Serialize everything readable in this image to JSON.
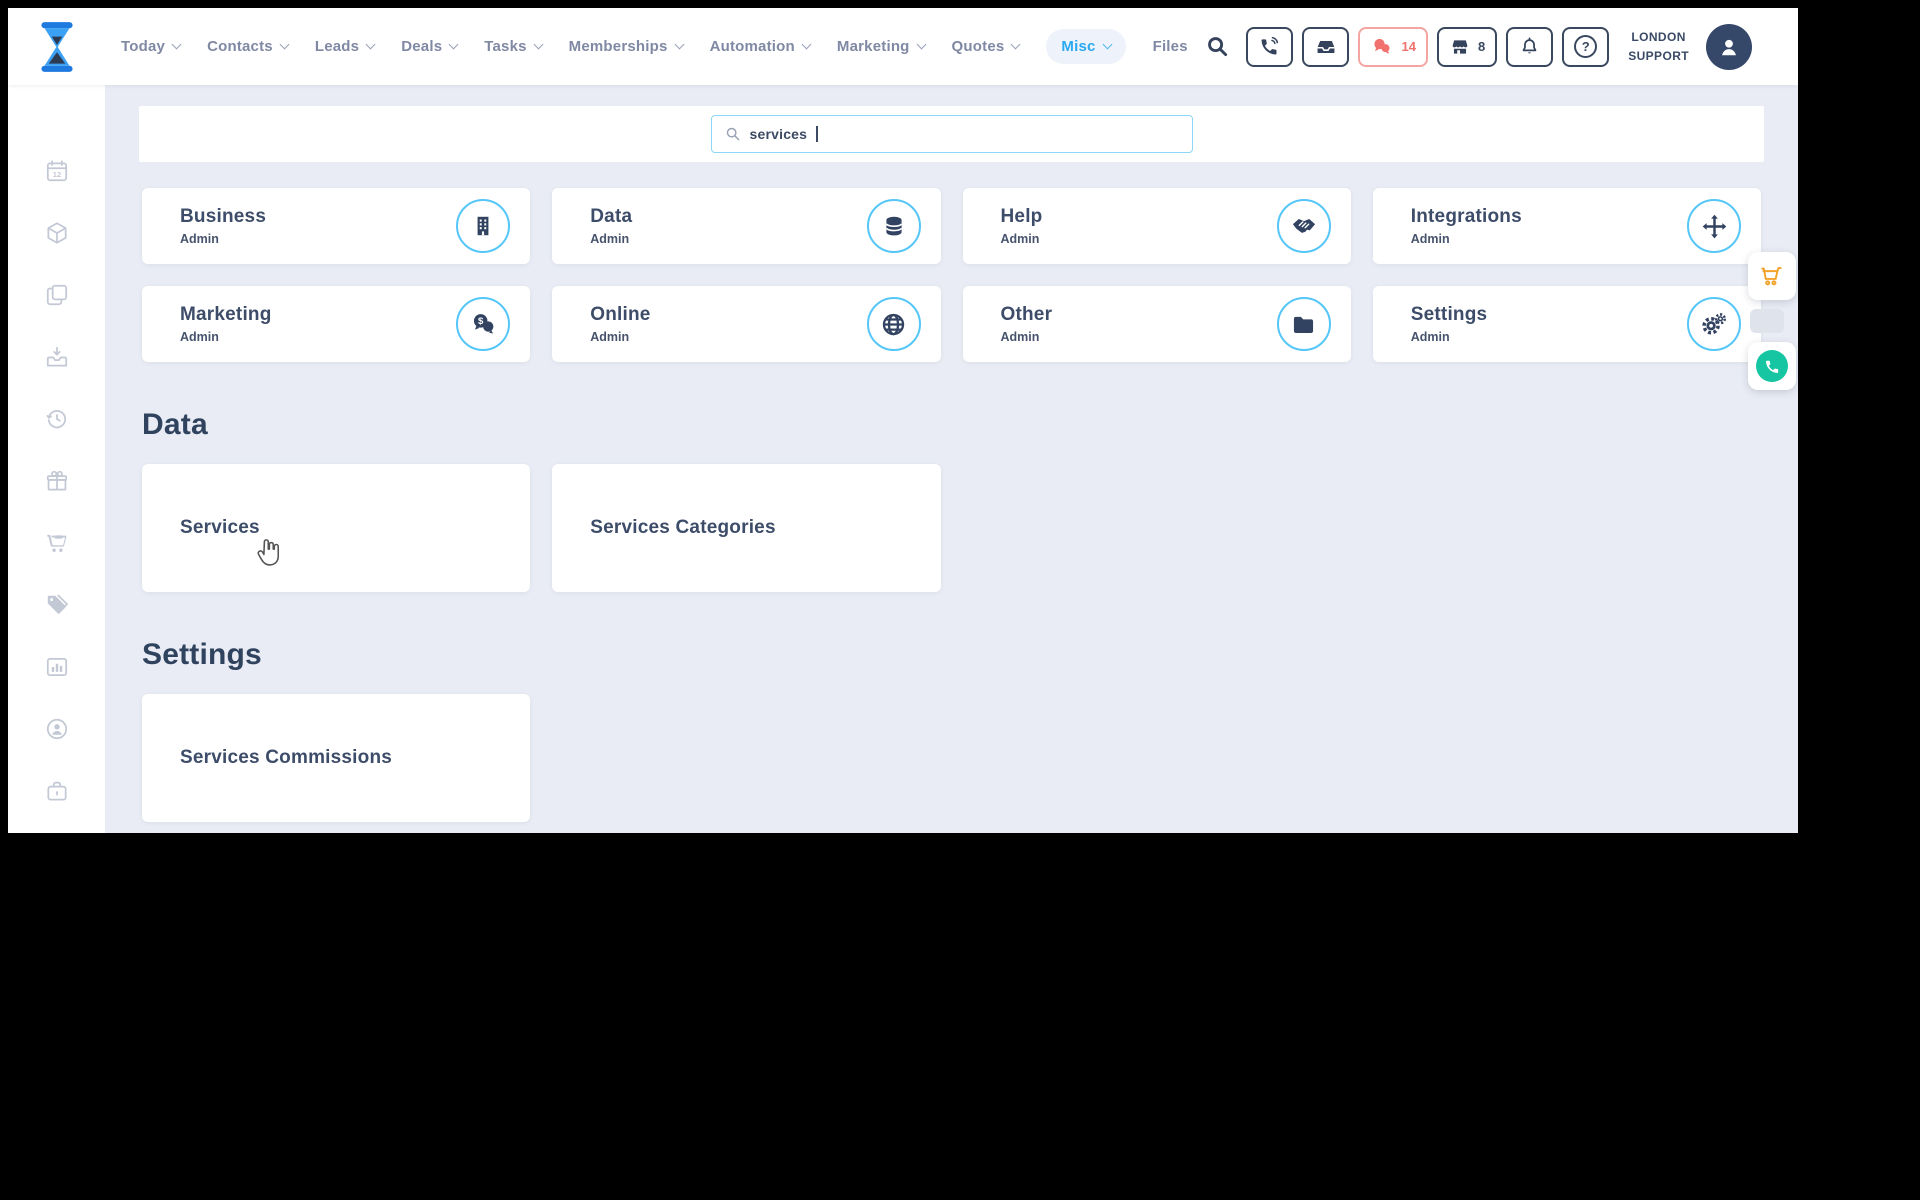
{
  "topbar": {
    "nav_items": [
      {
        "label": "Today"
      },
      {
        "label": "Contacts"
      },
      {
        "label": "Leads"
      },
      {
        "label": "Deals"
      },
      {
        "label": "Tasks"
      },
      {
        "label": "Memberships"
      },
      {
        "label": "Automation"
      },
      {
        "label": "Marketing"
      },
      {
        "label": "Quotes"
      },
      {
        "label": "Misc",
        "active": true
      },
      {
        "label": "Files"
      }
    ],
    "messages_badge": "14",
    "store_badge": "8",
    "help_glyph": "?",
    "user_line1": "LONDON",
    "user_line2": "SUPPORT"
  },
  "search": {
    "value": "services"
  },
  "category_cards": [
    {
      "title": "Business",
      "subtitle": "Admin",
      "icon": "building-icon"
    },
    {
      "title": "Data",
      "subtitle": "Admin",
      "icon": "database-icon"
    },
    {
      "title": "Help",
      "subtitle": "Admin",
      "icon": "handshake-icon"
    },
    {
      "title": "Integrations",
      "subtitle": "Admin",
      "icon": "arrows-move-icon"
    },
    {
      "title": "Marketing",
      "subtitle": "Admin",
      "icon": "comments-dollar-icon"
    },
    {
      "title": "Online",
      "subtitle": "Admin",
      "icon": "globe-icon"
    },
    {
      "title": "Other",
      "subtitle": "Admin",
      "icon": "folder-icon"
    },
    {
      "title": "Settings",
      "subtitle": "Admin",
      "icon": "gears-icon"
    }
  ],
  "sections": [
    {
      "title": "Data",
      "cards": [
        {
          "label": "Services"
        },
        {
          "label": "Services Categories"
        }
      ]
    },
    {
      "title": "Settings",
      "cards": [
        {
          "label": "Services Commissions"
        }
      ]
    }
  ],
  "colors": {
    "accent_blue": "#2aa9f2",
    "navy": "#3a485f",
    "alert_red": "#f0716d",
    "circle_blue": "#55c6f8",
    "cart_orange": "#f2a32b",
    "phone_teal": "#16c5a2",
    "content_bg": "#e9ecf4"
  }
}
